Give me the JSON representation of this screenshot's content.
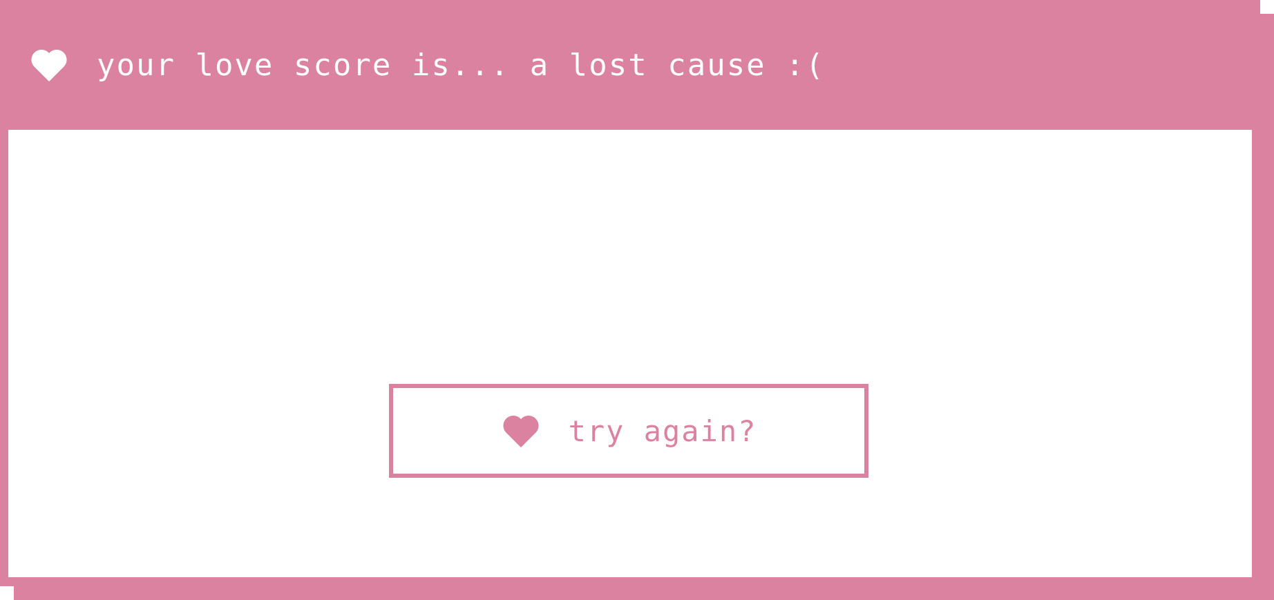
{
  "theme": {
    "accent": "#db82a0",
    "background": "#ffffff",
    "title_text_color": "#ffffff"
  },
  "window": {
    "title": "your love score is... a lost cause :(",
    "title_icon": "heart-icon"
  },
  "button": {
    "label": "try again?",
    "icon": "heart-icon"
  }
}
